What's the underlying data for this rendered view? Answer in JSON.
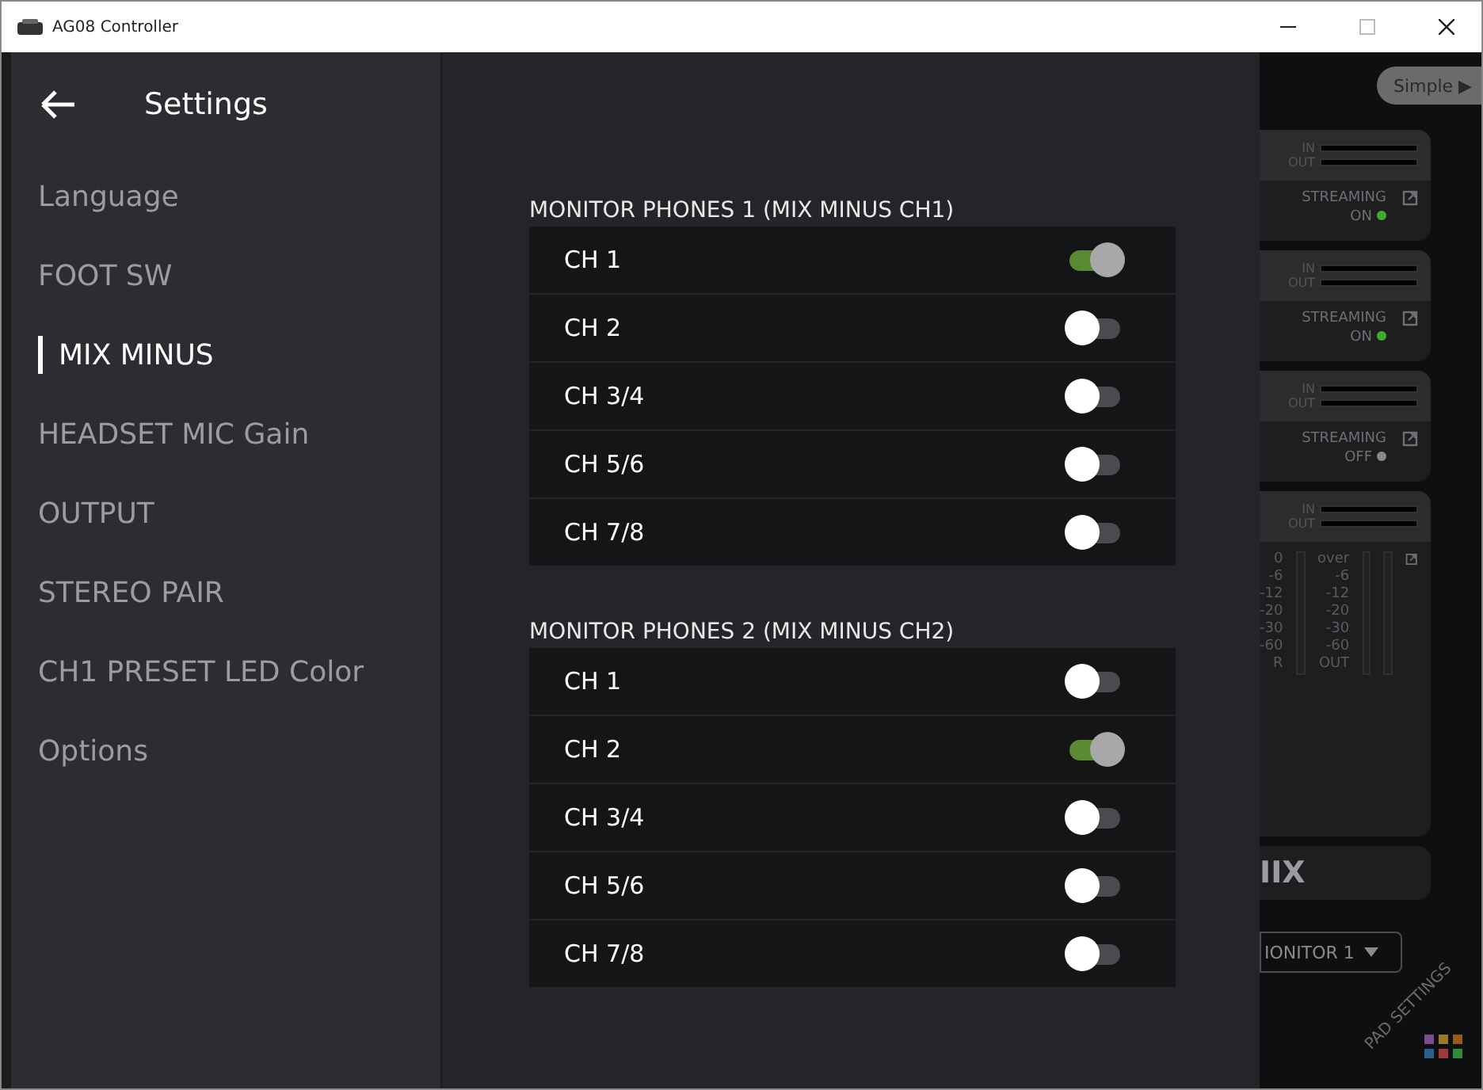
{
  "window": {
    "title": "AG08 Controller"
  },
  "sidebar": {
    "title": "Settings",
    "items": [
      {
        "label": "Language",
        "selected": false
      },
      {
        "label": "FOOT SW",
        "selected": false
      },
      {
        "label": "MIX MINUS",
        "selected": true
      },
      {
        "label": "HEADSET MIC Gain",
        "selected": false
      },
      {
        "label": "OUTPUT",
        "selected": false
      },
      {
        "label": "STEREO PAIR",
        "selected": false
      },
      {
        "label": "CH1 PRESET LED Color",
        "selected": false
      },
      {
        "label": "Options",
        "selected": false
      }
    ]
  },
  "sections": [
    {
      "title": "MONITOR PHONES 1 (MIX MINUS CH1)",
      "rows": [
        {
          "label": "CH 1",
          "on": true
        },
        {
          "label": "CH 2",
          "on": false
        },
        {
          "label": "CH 3/4",
          "on": false
        },
        {
          "label": "CH 5/6",
          "on": false
        },
        {
          "label": "CH 7/8",
          "on": false
        }
      ]
    },
    {
      "title": "MONITOR PHONES 2 (MIX MINUS CH2)",
      "rows": [
        {
          "label": "CH 1",
          "on": false
        },
        {
          "label": "CH 2",
          "on": true
        },
        {
          "label": "CH 3/4",
          "on": false
        },
        {
          "label": "CH 5/6",
          "on": false
        },
        {
          "label": "CH 7/8",
          "on": false
        }
      ]
    }
  ],
  "background": {
    "mode_button": "Simple ▶",
    "strips": [
      {
        "in": "IN",
        "out": "OUT",
        "label": "STREAMING",
        "status": "ON",
        "on": true
      },
      {
        "in": "IN",
        "out": "OUT",
        "label": "STREAMING",
        "status": "ON",
        "on": true
      },
      {
        "in": "IN",
        "out": "OUT",
        "label": "STREAMING",
        "status": "OFF",
        "on": false
      }
    ],
    "meter_card": {
      "in": "IN",
      "out": "OUT",
      "left_scale": [
        "0",
        "-6",
        "-12",
        "-20",
        "-30",
        "-60"
      ],
      "right_scale": [
        "over",
        "-6",
        "-12",
        "-20",
        "-30",
        "-60"
      ],
      "left_label": "R",
      "right_label": "OUT"
    },
    "mix_card": {
      "title": "IIX"
    },
    "dropdown": {
      "value": "IONITOR 1"
    },
    "pad_settings": "PAD SETTINGS"
  }
}
